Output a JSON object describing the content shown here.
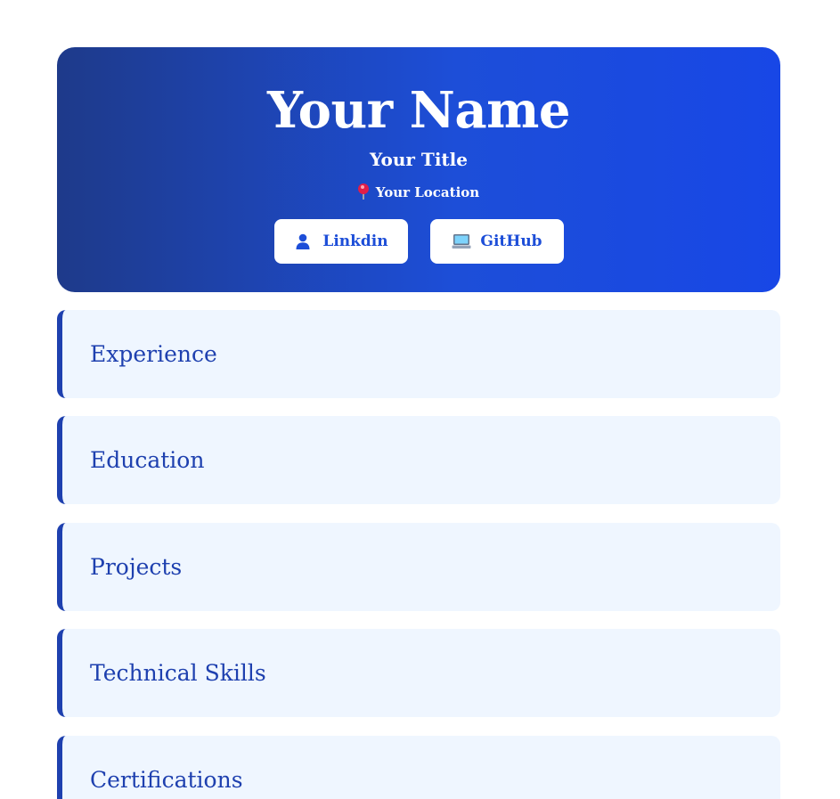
{
  "header": {
    "name": "Your Name",
    "title": "Your Title",
    "location": "Your Location",
    "location_icon": "map-pin-icon",
    "links": [
      {
        "label": "Linkdin",
        "icon": "person-icon"
      },
      {
        "label": "GitHub",
        "icon": "laptop-icon"
      }
    ]
  },
  "sections": [
    {
      "title": "Experience"
    },
    {
      "title": "Education"
    },
    {
      "title": "Projects"
    },
    {
      "title": "Technical Skills"
    },
    {
      "title": "Certifications"
    }
  ],
  "colors": {
    "hero_gradient_start": "#1e3a8a",
    "hero_gradient_end": "#1847e6",
    "accent": "#1e40af",
    "link_text": "#1d4ed8",
    "section_background": "#eff6ff"
  }
}
